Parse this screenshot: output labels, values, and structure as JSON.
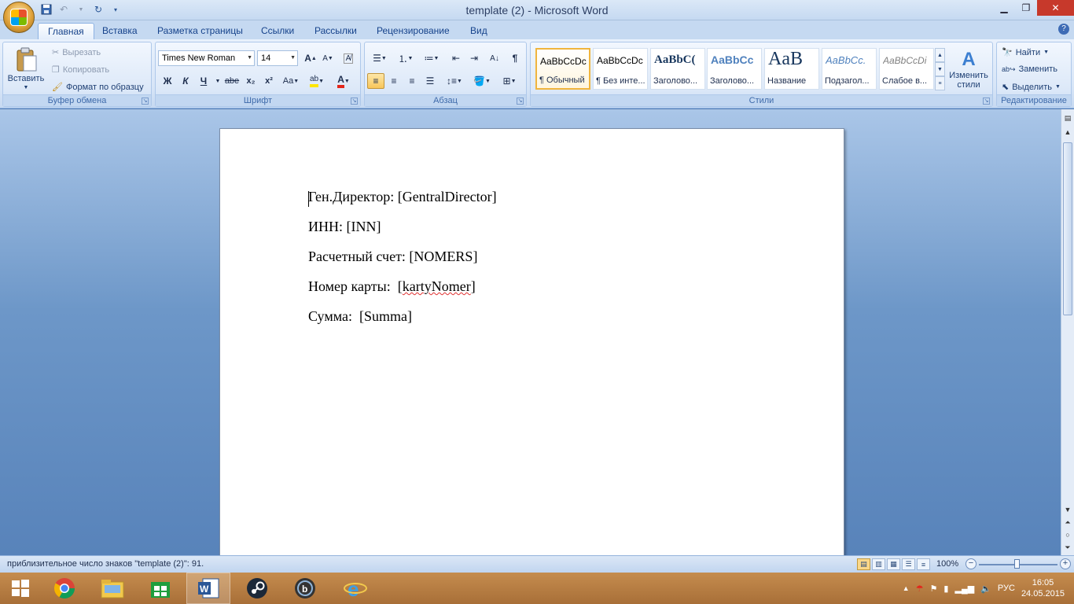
{
  "window": {
    "title": "template (2) - Microsoft Word"
  },
  "tabs": [
    "Главная",
    "Вставка",
    "Разметка страницы",
    "Ссылки",
    "Рассылки",
    "Рецензирование",
    "Вид"
  ],
  "clipboard": {
    "paste": "Вставить",
    "cut": "Вырезать",
    "copy": "Копировать",
    "format_painter": "Формат по образцу",
    "label": "Буфер обмена"
  },
  "font": {
    "name": "Times New Roman",
    "size": "14",
    "label": "Шрифт",
    "bold": "Ж",
    "italic": "К",
    "underline": "Ч",
    "strike": "abe",
    "subscript": "x₂",
    "superscript": "x²",
    "change_case": "Aa",
    "grow": "A",
    "shrink": "A",
    "font_color": "A"
  },
  "paragraph": {
    "label": "Абзац"
  },
  "styles": {
    "label": "Стили",
    "items": [
      {
        "sample": "AaBbCcDc",
        "name": "¶ Обычный"
      },
      {
        "sample": "AaBbCcDc",
        "name": "¶ Без инте..."
      },
      {
        "sample": "AaBbC(",
        "name": "Заголово..."
      },
      {
        "sample": "AaBbCc",
        "name": "Заголово..."
      },
      {
        "sample": "AaB",
        "name": "Название"
      },
      {
        "sample": "AaBbCc.",
        "name": "Подзагол..."
      },
      {
        "sample": "AaBbCcDi",
        "name": "Слабое в..."
      }
    ],
    "change_styles": "Изменить стили"
  },
  "editing": {
    "label": "Редактирование",
    "find": "Найти",
    "replace": "Заменить",
    "select": "Выделить"
  },
  "document": {
    "lines": [
      {
        "text": "Ген.Директор: [GentralDirector]"
      },
      {
        "text": "ИНН: [INN]"
      },
      {
        "text": "Расчетный счет: [NOMERS]"
      },
      {
        "prefix": "Номер карты:  [",
        "misspelled": "kartyNomer",
        "suffix": "]"
      },
      {
        "text": "Сумма:  [Summa]"
      }
    ]
  },
  "status": {
    "text": "приблизительное число знаков \"template (2)\": 91.",
    "zoom": "100%"
  },
  "taskbar": {
    "language": "РУС",
    "time": "16:05",
    "date": "24.05.2015"
  },
  "colors": {
    "ribbon_text": "#15428b",
    "taskbar": "#b57a3f",
    "close_button": "#c7392b"
  }
}
